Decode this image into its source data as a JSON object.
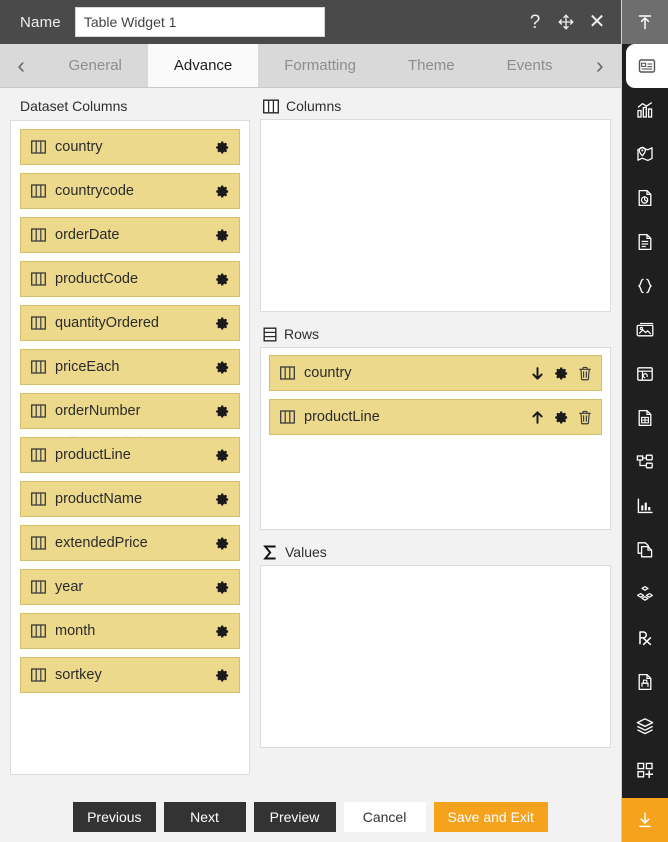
{
  "titlebar": {
    "name_label": "Name",
    "widget_name": "Table Widget 1",
    "name_placeholder": "Table Widget 1",
    "help_icon": "question-mark-icon",
    "move_icon": "move-icon",
    "close_icon": "close-icon"
  },
  "tabs": {
    "prev_arrow": "‹",
    "next_arrow": "›",
    "items": [
      {
        "label": "General",
        "active": false
      },
      {
        "label": "Advance",
        "active": true
      },
      {
        "label": "Formatting",
        "active": false
      },
      {
        "label": "Theme",
        "active": false
      },
      {
        "label": "Events",
        "active": false
      }
    ]
  },
  "dataset_columns": {
    "title": "Dataset Columns",
    "ghost_text": "Dataset Columns",
    "items": [
      {
        "label": "country"
      },
      {
        "label": "countrycode"
      },
      {
        "label": "orderDate"
      },
      {
        "label": "productCode"
      },
      {
        "label": "quantityOrdered"
      },
      {
        "label": "priceEach"
      },
      {
        "label": "orderNumber"
      },
      {
        "label": "productLine"
      },
      {
        "label": "productName"
      },
      {
        "label": "extendedPrice"
      },
      {
        "label": "year"
      },
      {
        "label": "month"
      },
      {
        "label": "sortkey"
      }
    ]
  },
  "zones": {
    "columns": {
      "title": "Columns",
      "icon": "columns-icon",
      "items": []
    },
    "rows": {
      "title": "Rows",
      "icon": "rows-icon",
      "items": [
        {
          "label": "country",
          "sort": "down"
        },
        {
          "label": "productLine",
          "sort": "up"
        }
      ]
    },
    "values": {
      "title": "Values",
      "icon": "sigma-icon",
      "items": []
    }
  },
  "footer": {
    "previous": "Previous",
    "next": "Next",
    "preview": "Preview",
    "cancel": "Cancel",
    "save_and_exit": "Save and Exit"
  },
  "rail": {
    "collapse_icon": "collapse-up-icon",
    "items": [
      {
        "icon": "widget-card-icon",
        "active": true
      },
      {
        "icon": "bar-chart-icon",
        "active": false
      },
      {
        "icon": "map-pin-icon",
        "active": false
      },
      {
        "icon": "report-pie-icon",
        "active": false
      },
      {
        "icon": "document-icon",
        "active": false
      },
      {
        "icon": "code-braces-icon",
        "active": false
      },
      {
        "icon": "image-gallery-icon",
        "active": false
      },
      {
        "icon": "calendar-widget-icon",
        "active": false
      },
      {
        "icon": "spreadsheet-icon",
        "active": false
      },
      {
        "icon": "hierarchy-icon",
        "active": false
      },
      {
        "icon": "chart-axis-icon",
        "active": false
      },
      {
        "icon": "copy-page-icon",
        "active": false
      },
      {
        "icon": "cubes-icon",
        "active": false
      },
      {
        "icon": "prescription-rx-icon",
        "active": false
      },
      {
        "icon": "saved-document-icon",
        "active": false
      },
      {
        "icon": "layers-icon",
        "active": false
      },
      {
        "icon": "add-widget-icon",
        "active": false
      }
    ],
    "bottom_icon": "download-icon"
  },
  "colors": {
    "chip": "#ecd98c",
    "chip_border": "#d6bf6a",
    "accent": "#f5a21d",
    "titlebar": "#4a4a4a",
    "rail": "#1f1f1f",
    "tabstrip": "#d9d9d9"
  }
}
